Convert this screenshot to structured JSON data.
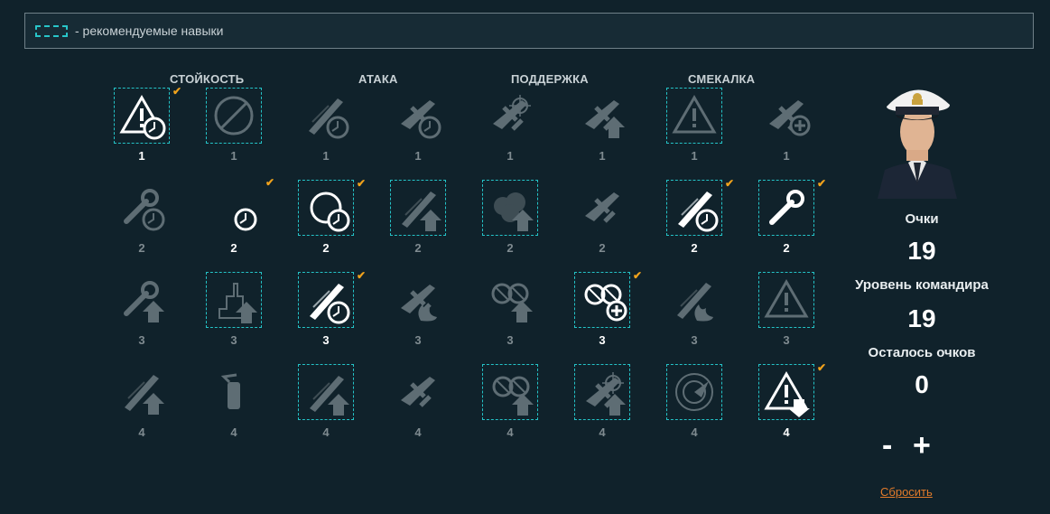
{
  "legend": {
    "text": "- рекомендуемые навыки"
  },
  "categories": [
    "СТОЙКОСТЬ",
    "АТАКА",
    "ПОДДЕРЖКА",
    "СМЕКАЛКА"
  ],
  "skills": [
    {
      "row": 0,
      "col": 0,
      "cost": "1",
      "rec": true,
      "sel": true,
      "icon": "warning-circle-icon"
    },
    {
      "row": 0,
      "col": 1,
      "cost": "1",
      "rec": true,
      "sel": false,
      "icon": "no-fire-icon"
    },
    {
      "row": 0,
      "col": 2,
      "cost": "1",
      "rec": false,
      "sel": false,
      "icon": "torpedo-timer-icon"
    },
    {
      "row": 0,
      "col": 3,
      "cost": "1",
      "rec": false,
      "sel": false,
      "icon": "plane-timer-icon"
    },
    {
      "row": 0,
      "col": 4,
      "cost": "1",
      "rec": false,
      "sel": false,
      "icon": "plane-crosshair-icon"
    },
    {
      "row": 0,
      "col": 5,
      "cost": "1",
      "rec": false,
      "sel": false,
      "icon": "plane-up-icon"
    },
    {
      "row": 0,
      "col": 6,
      "cost": "1",
      "rec": true,
      "sel": false,
      "icon": "torpedo-warning-icon"
    },
    {
      "row": 0,
      "col": 7,
      "cost": "1",
      "rec": false,
      "sel": false,
      "icon": "plane-plus-icon"
    },
    {
      "row": 1,
      "col": 0,
      "cost": "2",
      "rec": false,
      "sel": false,
      "icon": "wrench-timer-icon"
    },
    {
      "row": 1,
      "col": 1,
      "cost": "2",
      "rec": false,
      "sel": true,
      "icon": "stopwatch-icon"
    },
    {
      "row": 1,
      "col": 2,
      "cost": "2",
      "rec": true,
      "sel": true,
      "icon": "turret-rotate-icon"
    },
    {
      "row": 1,
      "col": 3,
      "cost": "2",
      "rec": true,
      "sel": false,
      "icon": "shell-up-icon"
    },
    {
      "row": 1,
      "col": 4,
      "cost": "2",
      "rec": true,
      "sel": false,
      "icon": "smoke-up-icon"
    },
    {
      "row": 1,
      "col": 5,
      "cost": "2",
      "rec": false,
      "sel": false,
      "icon": "plane-aa-icon"
    },
    {
      "row": 1,
      "col": 6,
      "cost": "2",
      "rec": true,
      "sel": true,
      "icon": "torpedo-reload-icon"
    },
    {
      "row": 1,
      "col": 7,
      "cost": "2",
      "rec": true,
      "sel": true,
      "icon": "gears-wrench-icon"
    },
    {
      "row": 2,
      "col": 0,
      "cost": "3",
      "rec": false,
      "sel": false,
      "icon": "wrench-up-icon"
    },
    {
      "row": 2,
      "col": 1,
      "cost": "3",
      "rec": true,
      "sel": false,
      "icon": "superstructure-up-icon"
    },
    {
      "row": 2,
      "col": 2,
      "cost": "3",
      "rec": true,
      "sel": true,
      "icon": "gun-timer-icon"
    },
    {
      "row": 2,
      "col": 3,
      "cost": "3",
      "rec": false,
      "sel": false,
      "icon": "plane-fire-icon"
    },
    {
      "row": 2,
      "col": 4,
      "cost": "3",
      "rec": false,
      "sel": false,
      "icon": "aa-up-icon"
    },
    {
      "row": 2,
      "col": 5,
      "cost": "3",
      "rec": true,
      "sel": true,
      "icon": "aa-plus-icon"
    },
    {
      "row": 2,
      "col": 6,
      "cost": "3",
      "rec": false,
      "sel": false,
      "icon": "torpedo-fire-icon"
    },
    {
      "row": 2,
      "col": 7,
      "cost": "3",
      "rec": true,
      "sel": false,
      "icon": "gun-warning-icon"
    },
    {
      "row": 3,
      "col": 0,
      "cost": "4",
      "rec": false,
      "sel": false,
      "icon": "shell-burst-up-icon"
    },
    {
      "row": 3,
      "col": 1,
      "cost": "4",
      "rec": false,
      "sel": false,
      "icon": "extinguisher-icon"
    },
    {
      "row": 3,
      "col": 2,
      "cost": "4",
      "rec": true,
      "sel": false,
      "icon": "shell-cross-up-icon"
    },
    {
      "row": 3,
      "col": 3,
      "cost": "4",
      "rec": false,
      "sel": false,
      "icon": "planes-swarm-icon"
    },
    {
      "row": 3,
      "col": 4,
      "cost": "4",
      "rec": true,
      "sel": false,
      "icon": "aa-double-up-icon"
    },
    {
      "row": 3,
      "col": 5,
      "cost": "4",
      "rec": true,
      "sel": false,
      "icon": "plane-crosshair-up-icon"
    },
    {
      "row": 3,
      "col": 6,
      "cost": "4",
      "rec": true,
      "sel": false,
      "icon": "radar-icon"
    },
    {
      "row": 3,
      "col": 7,
      "cost": "4",
      "rec": true,
      "sel": true,
      "icon": "warning-down-icon"
    }
  ],
  "side": {
    "points_label": "Очки",
    "points_value": "19",
    "level_label": "Уровень командира",
    "level_value": "19",
    "remaining_label": "Осталось очков",
    "remaining_value": "0",
    "minus": "-",
    "plus": "+",
    "reset": "Сбросить"
  },
  "colors": {
    "accent": "#24c3c7",
    "check": "#f0a21c",
    "reset": "#e07a2a",
    "background": "#10222b"
  }
}
